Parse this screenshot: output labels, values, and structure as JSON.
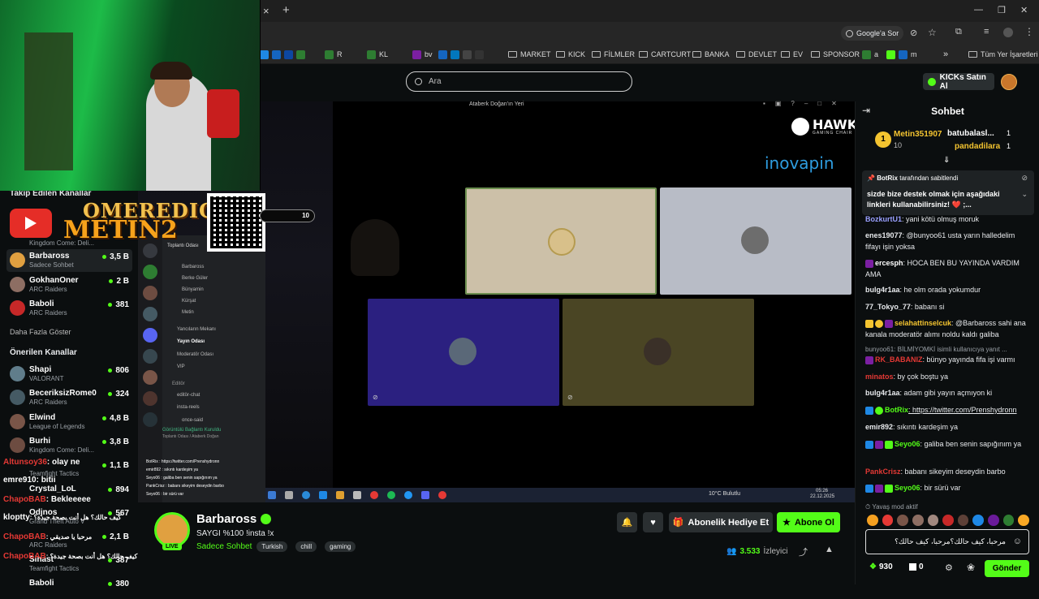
{
  "browser": {
    "new_tab": "+",
    "close_tab": "×",
    "google_sor": "Google'a Sor",
    "bookmarks": [
      {
        "label": "R",
        "color": "#1e88e5"
      },
      {
        "label": "KL",
        "color": "#2e7d32"
      },
      {
        "label": "bv",
        "color": "#7b1fa2"
      },
      {
        "label": "MARKET",
        "folder": true
      },
      {
        "label": "KICK",
        "folder": true
      },
      {
        "label": "FİLMLER",
        "folder": true
      },
      {
        "label": "CARTCURT",
        "folder": true
      },
      {
        "label": "BANKA",
        "folder": true
      },
      {
        "label": "DEVLET",
        "folder": true
      },
      {
        "label": "EV",
        "folder": true
      },
      {
        "label": "SPONSOR",
        "folder": true
      },
      {
        "label": "a",
        "color": "#2e7d32"
      },
      {
        "label": "m",
        "color": "#1565c0"
      },
      {
        "label": "»"
      },
      {
        "label": "Tüm Yer İşaretleri",
        "folder": true
      }
    ]
  },
  "header": {
    "search_placeholder": "Ara",
    "kicks_button": "KICKs Satın Al"
  },
  "sidebar": {
    "following_title": "Takip Edilen Kanallar",
    "channels": [
      {
        "name": "Barbaross",
        "sub": "Sadece Sohbet",
        "viewers": "3,5 B",
        "color": "#e0a040"
      },
      {
        "name": "GokhanOner",
        "sub": "ARC Raiders",
        "viewers": "2 B",
        "color": "#8d6e63"
      },
      {
        "name": "Baboli",
        "sub": "ARC Raiders",
        "viewers": "381",
        "color": "#c62828"
      }
    ],
    "hidden_sub": "Kingdom Come: Deli...",
    "more": "Daha Fazla Göster",
    "recommended_title": "Önerilen Kanallar",
    "recommended": [
      {
        "name": "Shapi",
        "sub": "VALORANT",
        "viewers": "806",
        "color": "#607d8b"
      },
      {
        "name": "BeceriksizRome0",
        "sub": "ARC Raiders",
        "viewers": "324",
        "color": "#455a64"
      },
      {
        "name": "Elwind",
        "sub": "League of Legends",
        "viewers": "4,8 B",
        "color": "#795548"
      },
      {
        "name": "Burhi",
        "sub": "Kingdom Come: Deli...",
        "viewers": "3,8 B",
        "color": "#6d4c41"
      },
      {
        "name": "",
        "sub": "Teamfight Tactics",
        "viewers": "1,1 B",
        "color": "#37474f"
      },
      {
        "name": "Crystal_LoL",
        "sub": "",
        "viewers": "894",
        "color": "#5d4037"
      },
      {
        "name": "Odjnos",
        "sub": "Grand Theft Auto V",
        "viewers": "567",
        "color": "#424242"
      },
      {
        "name": "",
        "sub": "ARC Raiders",
        "viewers": "2,1 B",
        "color": "#3e2723"
      },
      {
        "name": "Sinast",
        "sub": "Teamfight Tactics",
        "viewers": "387",
        "color": "#263238"
      },
      {
        "name": "Baboli",
        "sub": "",
        "viewers": "380",
        "color": "#c62828"
      }
    ]
  },
  "overlay": {
    "brand": "OMEREDIC",
    "brand2": "METIN2",
    "progress_value": "10",
    "chat": [
      {
        "user": "Altunsoy36",
        "text": ": olay ne",
        "color": "#e53935"
      },
      {
        "user": "emre910",
        "text": ": bitii",
        "color": "#fff"
      },
      {
        "user": "ChapoBAB",
        "text": ": Bekleeeee",
        "color": "#e53935"
      },
      {
        "user": "kloptty",
        "text": ": كيف حالك؟ هل أنت بصحة جيدة؟",
        "color": "#fff"
      },
      {
        "user": "ChapoBAB",
        "text": ": مرحبا يا صديقي",
        "color": "#e53935"
      },
      {
        "user": "ChapoBAB",
        "text": ": مرحبا يا صديقي، كيف حالك؟ هل أنت بصحة جيدة؟",
        "color": "#e53935"
      }
    ]
  },
  "discord": {
    "meeting_window_title": "Ataberk Doğan'ın Yeri",
    "channels": [
      "Toplantı Odası",
      "Barbaross",
      "Berke Güler",
      "Bünyamin",
      "Kürşat",
      "Metin",
      "Yancıların Mekanı",
      "Yayın Odası",
      "Moderatör Odası",
      "VIP",
      "Editör",
      "editör-chat",
      "insta-reels",
      "once-said"
    ],
    "voice_status": "Görüntülü Bağlantı Kuruldu",
    "voice_sub": "Toplantı Odası / Ataberk Doğan",
    "mini_chat": [
      "BotRix : https://twitter.com/Prenshydronn",
      "emir892 : sıkıntı kardeşim ya",
      "Seyo06 : galiba ben senin sapığınım ya",
      "PankCrisz : babanı sikeyim deseydin barbo",
      "Seyo06 : bir sürü var"
    ],
    "taskbar_weather": "10°C Bulutlu",
    "taskbar_time": "05:26",
    "taskbar_date": "22.12.2025"
  },
  "stream": {
    "logo_top": "HAWK",
    "logo_sub": "GAMING CHAIR",
    "sponsor": "inovapin"
  },
  "streamer": {
    "name": "Barbaross",
    "title": "SAYGI %100  !insta !x",
    "category": "Sadece Sohbet",
    "live_label": "LIVE",
    "tags": [
      "Turkish",
      "chill",
      "gaming"
    ],
    "gift_button": "Abonelik Hediye Et",
    "subscribe_button": "Abone Ol",
    "viewers": "3.533",
    "viewers_label": "İzleyici"
  },
  "chat": {
    "title": "Sohbet",
    "leaderboard": [
      {
        "rank": "1",
        "name": "Metin351907",
        "count": "10"
      },
      {
        "name": "batubalasl...",
        "count": "1"
      },
      {
        "name": "pandadilara",
        "count": "1"
      }
    ],
    "pinned_by_user": "BotRix",
    "pinned_by_suffix": "tarafından sabitlendi",
    "pinned_text": "sizde bize destek olmak için aşağıdaki linkleri kullanabilirsiniz! ❤️ ;...",
    "messages": [
      {
        "user": "BozkurtU1",
        "text": ": yani kötü olmuş moruk",
        "color": "#9aa0ff"
      },
      {
        "user": "enes19077",
        "text": ": @bunyoo61 usta yarın halledelim fifayı işin yoksa",
        "color": "#ffffff"
      },
      {
        "user": "ercesph",
        "text": ": HOCA BEN BU YAYINDA VARDIM AMA",
        "color": "#ffffff"
      },
      {
        "user": "bulg4r1aa",
        "text": ": he olm orada yokumdur",
        "color": "#ffffff"
      },
      {
        "user": "77_Tokyo_77",
        "text": ": babanı si",
        "color": "#ffffff"
      },
      {
        "user": "selahattinselcuk",
        "text": ": @Barbaross sahi ana kanala moderatör alımı noldu kaldı galiba",
        "color": "#f4c430"
      },
      {
        "user": "bunyoo61",
        "text": ": BİLMİYOMKİ isimli kullanıcıya yanıt ...",
        "color": "#9aa0a6"
      },
      {
        "user": "RK_BABANIZ",
        "text": ": bünyo yayında fifa işi varmı",
        "color": "#e53935"
      },
      {
        "user": "minatos",
        "text": ": by çok boştu ya",
        "color": "#e53935"
      },
      {
        "user": "bulg4r1aa",
        "text": ": adam gibi yayın açmıyon ki",
        "color": "#ffffff"
      },
      {
        "user": "BotRix",
        "text": ": https://twitter.com/Prenshydronn",
        "color": "#53fc18"
      },
      {
        "user": "emir892",
        "text": ": sıkıntı kardeşim ya",
        "color": "#ffffff"
      },
      {
        "user": "Seyo06",
        "text": ": galiba ben senin sapığınım ya",
        "color": "#53fc18"
      },
      {
        "user": "PankCrisz",
        "text": ": babanı sikeyim deseydin barbo",
        "color": "#e53935"
      },
      {
        "user": "Seyo06",
        "text": ": bir sürü var",
        "color": "#53fc18"
      }
    ],
    "slow_mode": "Yavaş mod aktif",
    "input_value": "مرحبا، كيف حالك؟مرحبا، كيف حالك؟",
    "points": "930",
    "points2": "0",
    "send_button": "Gönder"
  }
}
